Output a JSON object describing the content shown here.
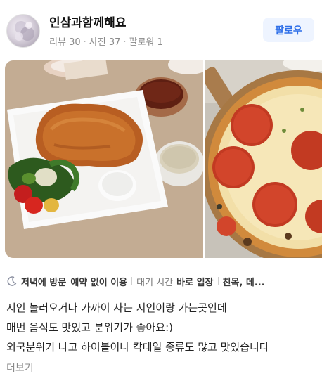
{
  "profile": {
    "name": "인삼과함께해요",
    "stats": [
      {
        "label": "리뷰",
        "value": "30"
      },
      {
        "label": "사진",
        "value": "37"
      },
      {
        "label": "팔로워",
        "value": "1"
      }
    ],
    "follow_label": "팔로우"
  },
  "photos": [
    {
      "icon": "food-photo-pork-cutlet"
    },
    {
      "icon": "food-photo-pepperoni-pizza"
    }
  ],
  "tags": {
    "icon": "moon-icon",
    "visit_time": "저녁에 방문",
    "reservation": "예약 없이 이용",
    "wait_label": "대기 시간",
    "wait_value": "바로 입장",
    "purpose": "친목, 데..."
  },
  "review": {
    "lines": [
      "지인 놀러오거나 가까이 사는 지인이랑 가는곳인데",
      "매번 음식도 맛있고 분위기가 좋아요:)",
      "외국분위기 나고 하이볼이나 칵테일 종류도 많고 맛있습니다"
    ],
    "more_label": "더보기"
  },
  "colors": {
    "accent": "#2f6fe8",
    "follow_bg": "#eef4ff",
    "muted": "#8a8a8a"
  }
}
